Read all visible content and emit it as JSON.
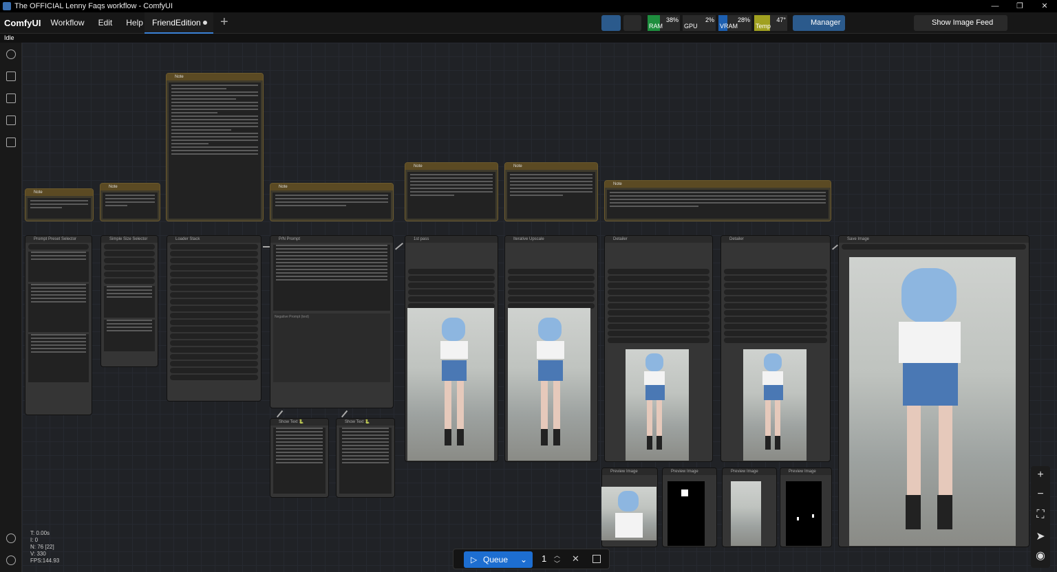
{
  "window": {
    "title": "The OFFICIAL Lenny Faqs workflow - ComfyUI"
  },
  "menu": {
    "brand": "ComfyUI",
    "items": [
      "Workflow",
      "Edit",
      "Help"
    ]
  },
  "tab": {
    "label": "FriendEdition"
  },
  "status": {
    "text": "Idle"
  },
  "toolbar": {
    "ram_label": "RAM",
    "ram_pct": "38%",
    "gpu_label": "GPU",
    "gpu_pct": "2%",
    "vram_label": "VRAM",
    "vram_pct": "28%",
    "temp_label": "Temp",
    "temp_val": "47°",
    "manager_label": "Manager",
    "feed_label": "Show Image Feed"
  },
  "colors": {
    "accent": "#1d6ed1",
    "note_header": "#5b4a23",
    "ram": "#1e8e3e",
    "vram": "#1d5fb0",
    "temp": "#a0a020"
  },
  "nodes": {
    "note": "Note",
    "prompt_preset": "Prompt Preset Selector",
    "size_selector": "Simple Size Selector",
    "loader_stack": "Loader Stack",
    "pn_prompt": "P/N Prompt",
    "first_pass": "1st pass",
    "iter_upscale": "Iterative Upscale",
    "detailer1": "Detailer",
    "detailer2": "Detailer",
    "save_image": "Save Image",
    "show_text1": "Show Text 🐍",
    "show_text2": "Show Text 🐍",
    "preview1": "Preview Image",
    "preview2": "Preview Image",
    "preview3": "Preview Image",
    "preview4": "Preview Image",
    "negative": "Negative Prompt (text)"
  },
  "queue": {
    "label": "Queue",
    "count": "1"
  },
  "stats": {
    "t": "T: 0.00s",
    "i": "I: 0",
    "n": "N: 76 [22]",
    "v": "V: 330",
    "fps": "FPS:144.93"
  }
}
